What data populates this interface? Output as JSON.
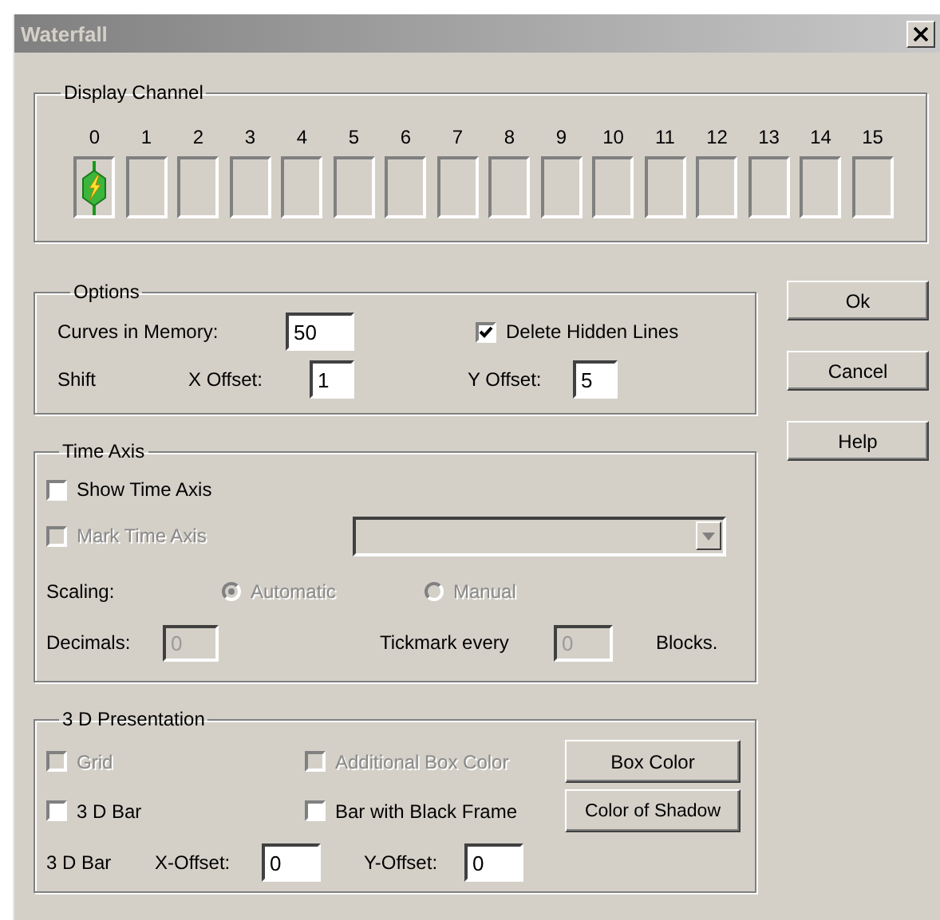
{
  "window": {
    "title": "Waterfall"
  },
  "display_channel": {
    "title": "Display Channel",
    "channels": [
      {
        "label": "0",
        "selected": true
      },
      {
        "label": "1",
        "selected": false
      },
      {
        "label": "2",
        "selected": false
      },
      {
        "label": "3",
        "selected": false
      },
      {
        "label": "4",
        "selected": false
      },
      {
        "label": "5",
        "selected": false
      },
      {
        "label": "6",
        "selected": false
      },
      {
        "label": "7",
        "selected": false
      },
      {
        "label": "8",
        "selected": false
      },
      {
        "label": "9",
        "selected": false
      },
      {
        "label": "10",
        "selected": false
      },
      {
        "label": "11",
        "selected": false
      },
      {
        "label": "12",
        "selected": false
      },
      {
        "label": "13",
        "selected": false
      },
      {
        "label": "14",
        "selected": false
      },
      {
        "label": "15",
        "selected": false
      }
    ]
  },
  "options": {
    "title": "Options",
    "curves_label": "Curves in Memory:",
    "curves_value": "50",
    "delete_hidden_lines": {
      "label": "Delete Hidden Lines",
      "checked": true,
      "disabled": false
    },
    "shift_label": "Shift",
    "x_offset_label": "X Offset:",
    "x_offset_value": "1",
    "y_offset_label": "Y Offset:",
    "y_offset_value": "5"
  },
  "time_axis": {
    "title": "Time Axis",
    "show_time_axis": {
      "label": "Show Time Axis",
      "checked": false,
      "disabled": false
    },
    "mark_time_axis": {
      "label": "Mark Time Axis",
      "checked": false,
      "disabled": true
    },
    "mark_select": {
      "disabled": true
    },
    "scaling_label": "Scaling:",
    "scaling_options": [
      {
        "label": "Automatic",
        "selected": true,
        "disabled": true
      },
      {
        "label": "Manual",
        "selected": false,
        "disabled": true
      }
    ],
    "decimals_label": "Decimals:",
    "decimals_value": "0",
    "decimals_disabled": true,
    "tickmark_label": "Tickmark every",
    "tickmark_value": "0",
    "tickmark_disabled": true,
    "blocks_label": "Blocks."
  },
  "presentation": {
    "title": "3 D Presentation",
    "checkboxes": [
      {
        "label": "Grid",
        "checked": false,
        "disabled": true
      },
      {
        "label": "Additional Box Color",
        "checked": false,
        "disabled": true
      },
      {
        "label": "3 D Bar",
        "checked": false,
        "disabled": false
      },
      {
        "label": "Bar with Black Frame",
        "checked": false,
        "disabled": false
      }
    ],
    "buttons": [
      "Box Color",
      "Color of Shadow"
    ],
    "bar_label": "3 D Bar",
    "x_offset_label": "X-Offset:",
    "x_offset_value": "0",
    "y_offset_label": "Y-Offset:",
    "y_offset_value": "0"
  },
  "buttons": [
    "Ok",
    "Cancel",
    "Help"
  ]
}
